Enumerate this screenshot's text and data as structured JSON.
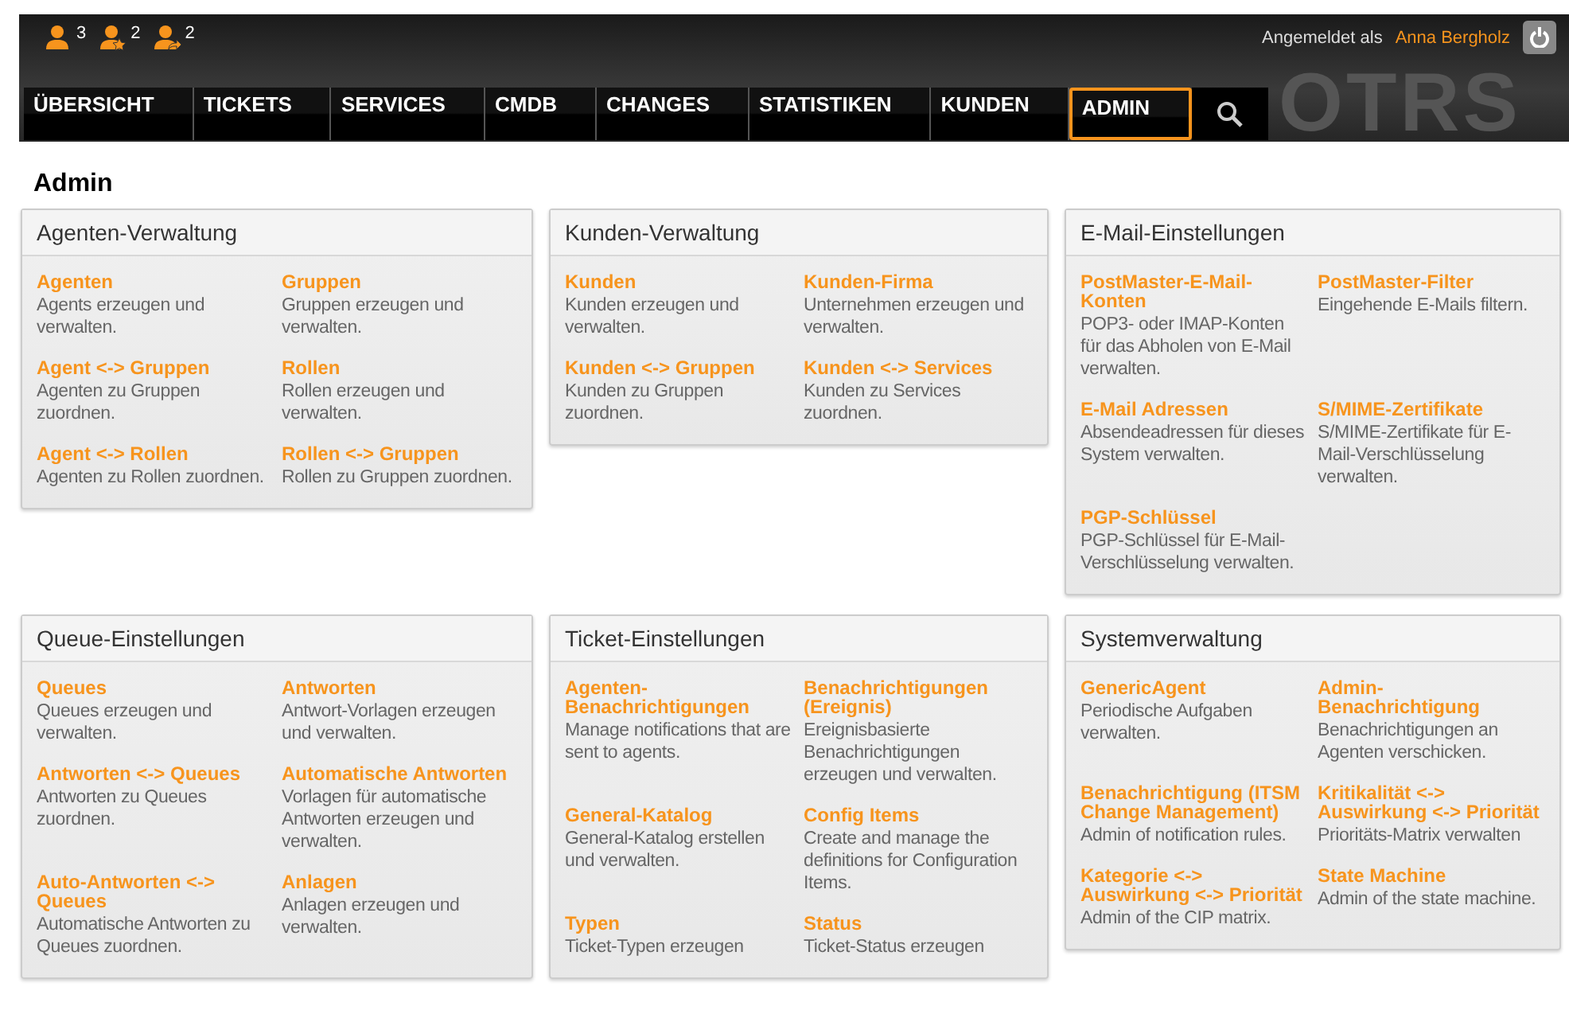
{
  "header": {
    "toolbar": [
      {
        "kind": "person",
        "count": "3"
      },
      {
        "kind": "star",
        "count": "2"
      },
      {
        "kind": "arrow",
        "count": "2"
      }
    ],
    "login_label": "Angemeldet als",
    "user": "Anna Bergholz",
    "logo": "OTRS"
  },
  "nav": [
    {
      "label": "ÜBERSICHT",
      "selected": false
    },
    {
      "label": "TICKETS",
      "selected": false
    },
    {
      "label": "SERVICES",
      "selected": false
    },
    {
      "label": "CMDB",
      "selected": false
    },
    {
      "label": "CHANGES",
      "selected": false
    },
    {
      "label": "STATISTIKEN",
      "selected": false
    },
    {
      "label": "KUNDEN",
      "selected": false
    },
    {
      "label": "ADMIN",
      "selected": true
    }
  ],
  "page_title": "Admin",
  "sections": [
    {
      "title": "Agenten-Verwaltung",
      "items": [
        {
          "title": "Agenten",
          "description": "Agents erzeugen und verwalten."
        },
        {
          "title": "Gruppen",
          "description": "Gruppen erzeugen und verwalten."
        },
        {
          "title": "Agent <-> Gruppen",
          "description": "Agenten zu Gruppen zuordnen."
        },
        {
          "title": "Rollen",
          "description": "Rollen erzeugen und verwalten."
        },
        {
          "title": "Agent <-> Rollen",
          "description": "Agenten zu Rollen zuordnen."
        },
        {
          "title": "Rollen <-> Gruppen",
          "description": "Rollen zu Gruppen zuordnen."
        }
      ]
    },
    {
      "title": "Kunden-Verwaltung",
      "items": [
        {
          "title": "Kunden",
          "description": "Kunden erzeugen und verwalten."
        },
        {
          "title": "Kunden-Firma",
          "description": "Unternehmen erzeugen und verwalten."
        },
        {
          "title": "Kunden <-> Gruppen",
          "description": "Kunden zu Gruppen zuordnen."
        },
        {
          "title": "Kunden <-> Services",
          "description": "Kunden zu Services zuordnen."
        }
      ]
    },
    {
      "title": "E-Mail-Einstellungen",
      "items": [
        {
          "title": "PostMaster-E-Mail-Konten",
          "description": "POP3- oder IMAP-Konten für das Abholen von E-Mail verwalten."
        },
        {
          "title": "PostMaster-Filter",
          "description": "Eingehende E-Mails filtern."
        },
        {
          "title": "E-Mail Adressen",
          "description": "Absendeadressen für dieses System verwalten."
        },
        {
          "title": "S/MIME-Zertifikate",
          "description": "S/MIME-Zertifikate für E-Mail-Verschlüsselung verwalten."
        },
        {
          "title": "PGP-Schlüssel",
          "description": "PGP-Schlüssel für E-Mail-Verschlüsselung verwalten."
        }
      ]
    },
    {
      "title": "Queue-Einstellungen",
      "items": [
        {
          "title": "Queues",
          "description": "Queues erzeugen und verwalten."
        },
        {
          "title": "Antworten",
          "description": "Antwort-Vorlagen erzeugen und verwalten."
        },
        {
          "title": "Antworten <-> Queues",
          "description": "Antworten zu Queues zuordnen."
        },
        {
          "title": "Automatische Antworten",
          "description": "Vorlagen für automatische Antworten erzeugen und verwalten."
        },
        {
          "title": "Auto-Antworten <-> Queues",
          "description": "Automatische Antworten zu Queues zuordnen."
        },
        {
          "title": "Anlagen",
          "description": "Anlagen erzeugen und verwalten."
        }
      ]
    },
    {
      "title": "Ticket-Einstellungen",
      "items": [
        {
          "title": "Agenten-Benachrichtigungen",
          "description": "Manage notifications that are sent to agents."
        },
        {
          "title": "Benachrichtigungen (Ereignis)",
          "description": "Ereignisbasierte Benachrichtigungen erzeugen und verwalten."
        },
        {
          "title": "General-Katalog",
          "description": "General-Katalog erstellen und verwalten."
        },
        {
          "title": "Config Items",
          "description": "Create and manage the definitions for Configuration Items."
        },
        {
          "title": "Typen",
          "description": "Ticket-Typen erzeugen"
        },
        {
          "title": "Status",
          "description": "Ticket-Status erzeugen"
        }
      ]
    },
    {
      "title": "Systemverwaltung",
      "items": [
        {
          "title": "GenericAgent",
          "description": "Periodische Aufgaben verwalten."
        },
        {
          "title": "Admin-Benachrichtigung",
          "description": "Benachrichtigungen an Agenten verschicken."
        },
        {
          "title": "Benachrichtigung (ITSM Change Management)",
          "description": "Admin of notification rules."
        },
        {
          "title": "Kritikalität <-> Auswirkung <-> Priorität",
          "description": "Prioritäts-Matrix verwalten"
        },
        {
          "title": "Kategorie <-> Auswirkung <-> Priorität",
          "description": "Admin of the CIP matrix."
        },
        {
          "title": "State Machine",
          "description": "Admin of the state machine."
        }
      ]
    }
  ]
}
